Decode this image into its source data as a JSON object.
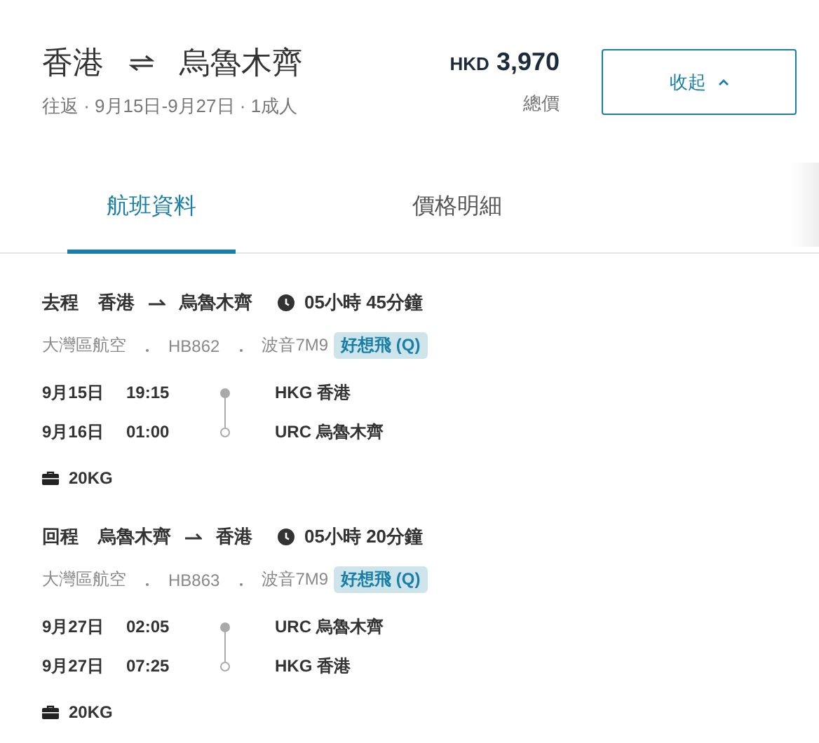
{
  "header": {
    "origin": "香港",
    "destination": "烏魯木齊",
    "trip_info": "往返 · 9月15日-9月27日 · 1成人",
    "currency": "HKD",
    "price": "3,970",
    "price_label": "總價",
    "collapse_button": "收起"
  },
  "tabs": [
    {
      "label": "航班資料",
      "selected": true
    },
    {
      "label": "價格明細",
      "selected": false
    }
  ],
  "legs": [
    {
      "direction": "去程",
      "from": "香港",
      "to": "烏魯木齊",
      "duration": "05小時 45分鐘",
      "airline": "大灣區航空",
      "flight_no": "HB862",
      "aircraft": "波音7M9",
      "fare": "好想飛 (Q)",
      "stops": [
        {
          "date": "9月15日",
          "time": "19:15",
          "airport": "HKG 香港"
        },
        {
          "date": "9月16日",
          "time": "01:00",
          "airport": "URC 烏魯木齊"
        }
      ],
      "baggage": "20KG"
    },
    {
      "direction": "回程",
      "from": "烏魯木齊",
      "to": "香港",
      "duration": "05小時 20分鐘",
      "airline": "大灣區航空",
      "flight_no": "HB863",
      "aircraft": "波音7M9",
      "fare": "好想飛 (Q)",
      "stops": [
        {
          "date": "9月27日",
          "time": "02:05",
          "airport": "URC 烏魯木齊"
        },
        {
          "date": "9月27日",
          "time": "07:25",
          "airport": "HKG 香港"
        }
      ],
      "baggage": "20KG"
    }
  ]
}
